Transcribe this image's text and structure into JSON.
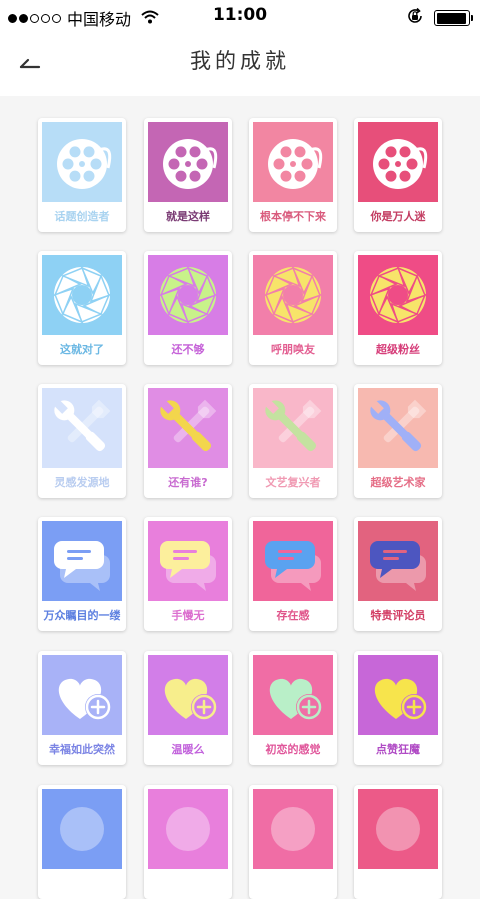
{
  "status": {
    "carrier": "中国移动",
    "time": "11:00",
    "signal_dots": [
      true,
      true,
      false,
      false,
      false
    ],
    "battery_level": 0.95
  },
  "nav": {
    "back_icon": "back-arrow-icon",
    "title": "我的成就"
  },
  "badges": [
    {
      "label": "话题创造者",
      "icon": "film-reel-icon",
      "bg": "#b7ddf7",
      "fg": "#ffffff",
      "label_color": "#a9d3f0",
      "unlocked": false
    },
    {
      "label": "就是这样",
      "icon": "film-reel-icon",
      "bg": "#c466b4",
      "fg": "#ffffff",
      "label_color": "#7a3b74",
      "unlocked": true
    },
    {
      "label": "根本停不下来",
      "icon": "film-reel-icon",
      "bg": "#f286a2",
      "fg": "#ffffff",
      "label_color": "#d95b7d",
      "unlocked": true
    },
    {
      "label": "你是万人迷",
      "icon": "film-reel-icon",
      "bg": "#e74f7a",
      "fg": "#ffffff",
      "label_color": "#c33d62",
      "unlocked": true
    },
    {
      "label": "这就对了",
      "icon": "aperture-icon",
      "bg": "#8ed1f4",
      "fg": "#ffffff",
      "label_color": "#6ab7e3",
      "unlocked": true
    },
    {
      "label": "还不够",
      "icon": "aperture-icon",
      "bg": "#d77de6",
      "fg": "#c8f28a",
      "label_color": "#c560d8",
      "unlocked": true
    },
    {
      "label": "呼朋唤友",
      "icon": "aperture-icon",
      "bg": "#f27faa",
      "fg": "#f7e46a",
      "label_color": "#e35f92",
      "unlocked": true
    },
    {
      "label": "超级粉丝",
      "icon": "aperture-icon",
      "bg": "#ef4c86",
      "fg": "#f7e46a",
      "label_color": "#d63d79",
      "unlocked": true
    },
    {
      "label": "灵感发源地",
      "icon": "tools-icon",
      "bg": "#d5e2fb",
      "fg": "#ffffff",
      "label_color": "#b9cdf0",
      "unlocked": false
    },
    {
      "label": "还有谁?",
      "icon": "tools-icon",
      "bg": "#e08de4",
      "fg": "#f3d64c",
      "label_color": "#c86bd0",
      "unlocked": true
    },
    {
      "label": "文艺复兴者",
      "icon": "tools-icon",
      "bg": "#f9b7c9",
      "fg": "#c4e2a0",
      "label_color": "#f09ab3",
      "unlocked": true
    },
    {
      "label": "超级艺术家",
      "icon": "tools-icon",
      "bg": "#f7b9b0",
      "fg": "#a0b0f7",
      "label_color": "#e56d86",
      "unlocked": true
    },
    {
      "label": "万众瞩目的一缕",
      "icon": "chat-bubbles-icon",
      "bg": "#7b9ef4",
      "fg": "#ffffff",
      "label_color": "#5c7fe0",
      "unlocked": true
    },
    {
      "label": "手慢无",
      "icon": "chat-bubbles-icon",
      "bg": "#e87fdc",
      "fg": "#fcef9c",
      "label_color": "#dc6fcf",
      "unlocked": true
    },
    {
      "label": "存在感",
      "icon": "chat-bubbles-icon",
      "bg": "#f0659a",
      "fg": "#5aa2f0",
      "label_color": "#e0558b",
      "unlocked": true
    },
    {
      "label": "特贵评论员",
      "icon": "chat-bubbles-icon",
      "bg": "#e2637f",
      "fg": "#4d56c0",
      "label_color": "#d23c63",
      "unlocked": true
    },
    {
      "label": "幸福如此突然",
      "icon": "heart-plus-icon",
      "bg": "#a8b2f7",
      "fg": "#ffffff",
      "label_color": "#7b84e4",
      "unlocked": true
    },
    {
      "label": "温暖么",
      "icon": "heart-plus-icon",
      "bg": "#d27ee8",
      "fg": "#f7ee8c",
      "label_color": "#c262dc",
      "unlocked": true
    },
    {
      "label": "初恋的感觉",
      "icon": "heart-plus-icon",
      "bg": "#f06da5",
      "fg": "#b9efc8",
      "label_color": "#e0559a",
      "unlocked": true
    },
    {
      "label": "点赞狂魔",
      "icon": "heart-plus-icon",
      "bg": "#c767d8",
      "fg": "#f7e44c",
      "label_color": "#b04bc5",
      "unlocked": true
    },
    {
      "label": "",
      "icon": "badge-icon",
      "bg": "#7b9ef4",
      "fg": "#ffffff",
      "label_color": "#7b9ef4",
      "unlocked": true
    },
    {
      "label": "",
      "icon": "badge-icon",
      "bg": "#e87fdc",
      "fg": "#ffffff",
      "label_color": "#e87fdc",
      "unlocked": true
    },
    {
      "label": "",
      "icon": "badge-icon",
      "bg": "#f06da5",
      "fg": "#ffffff",
      "label_color": "#f06da5",
      "unlocked": true
    },
    {
      "label": "",
      "icon": "badge-icon",
      "bg": "#ec5a88",
      "fg": "#ffffff",
      "label_color": "#ec5a88",
      "unlocked": true
    }
  ]
}
